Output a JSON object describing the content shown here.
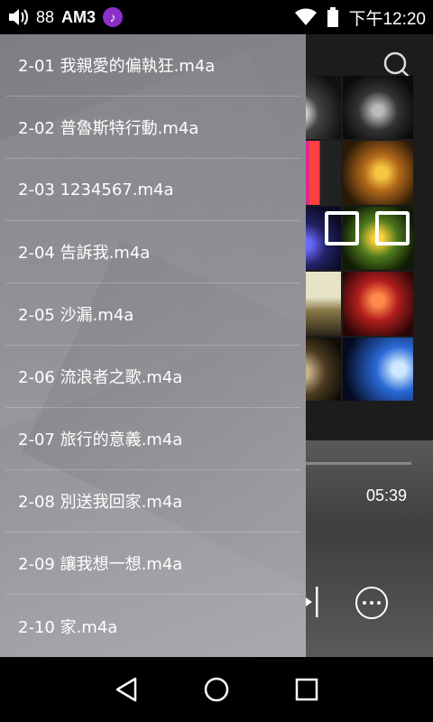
{
  "status_bar": {
    "volume_icon": "speaker-icon",
    "volume_level": "88",
    "am3_label": "AM3",
    "music_icon": "music-note-icon",
    "time": "下午12:20",
    "wifi_icon": "wifi-icon",
    "battery_icon": "battery-icon"
  },
  "player": {
    "search_icon": "search-icon",
    "total_time": "05:39",
    "next_icon": "skip-next-icon",
    "more_icon": "more-options-icon"
  },
  "drawer": {
    "tracks": [
      {
        "label": "2-01 我親愛的偏執狂.m4a"
      },
      {
        "label": "2-02 普魯斯特行動.m4a"
      },
      {
        "label": "2-03 1234567.m4a"
      },
      {
        "label": "2-04 告訴我.m4a"
      },
      {
        "label": "2-05 沙漏.m4a"
      },
      {
        "label": "2-06 流浪者之歌.m4a"
      },
      {
        "label": "2-07 旅行的意義.m4a"
      },
      {
        "label": "2-08 別送我回家.m4a"
      },
      {
        "label": "2-09 讓我想一想.m4a"
      },
      {
        "label": "2-10 家.m4a"
      }
    ]
  },
  "nav_bar": {
    "back_icon": "back-triangle-icon",
    "home_icon": "home-circle-icon",
    "recents_icon": "recents-square-icon"
  }
}
